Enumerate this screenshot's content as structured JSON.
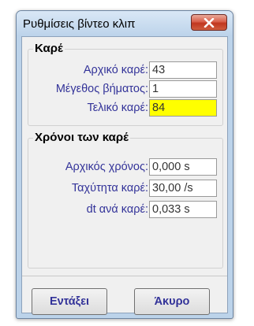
{
  "window": {
    "title": "Ρυθμίσεις βίντεο κλιπ"
  },
  "frames": {
    "title": "Καρέ",
    "start_frame": {
      "label": "Αρχικό καρέ:",
      "value": "43"
    },
    "step_size": {
      "label": "Μέγεθος βήματος:",
      "value": "1"
    },
    "end_frame": {
      "label": "Τελικό καρέ:",
      "value": "84"
    }
  },
  "frame_times": {
    "title": "Χρόνοι των καρέ",
    "start_time": {
      "label": "Αρχικός χρόνος:",
      "value": "0,000 s"
    },
    "frame_rate": {
      "label": "Ταχύτητα καρέ:",
      "value": "30,00 /s"
    },
    "dt_per_frame": {
      "label": "dt ανά καρέ:",
      "value": "0,033 s"
    }
  },
  "buttons": {
    "ok": "Εντάξει",
    "cancel": "Άκυρο"
  },
  "colors": {
    "highlight_field": "#ffff00",
    "label_text": "#333399",
    "close_button": "#c8412b"
  }
}
